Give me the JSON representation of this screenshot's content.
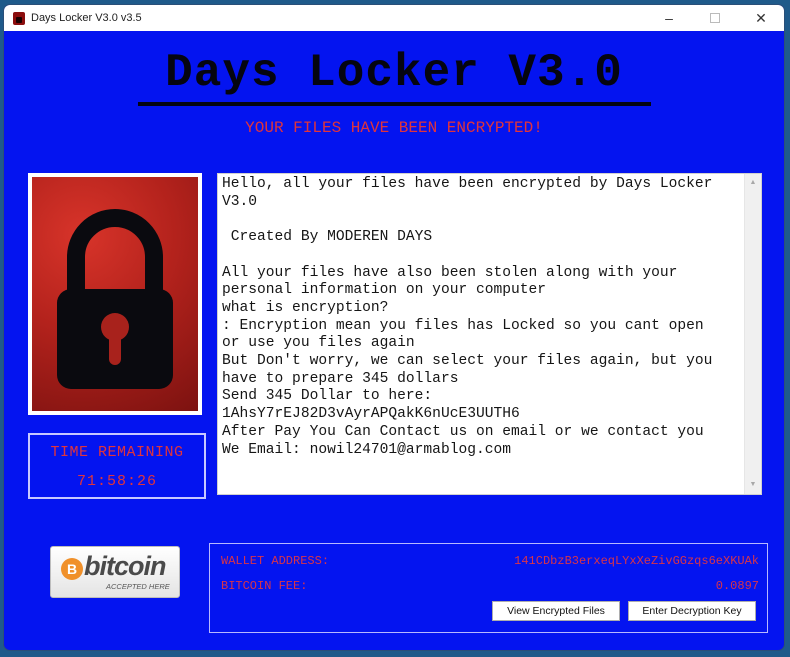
{
  "window": {
    "title": "Days Locker V3.0 v3.5",
    "controls": {
      "minimize": "–",
      "close": "✕"
    }
  },
  "header": {
    "title": "Days Locker V3.0",
    "subtitle": "YOUR FILES HAVE BEEN ENCRYPTED!"
  },
  "lock_image": {
    "icon": "padlock-icon"
  },
  "timer": {
    "label": "TIME REMAINING",
    "value": "71:58:26"
  },
  "ransom_note": {
    "text": "Hello, all your files have been encrypted by Days Locker\nV3.0\n\n Created By MODEREN DAYS\n\nAll your files have also been stolen along with your\npersonal information on your computer\nwhat is encryption?\n: Encryption mean you files has Locked so you cant open\nor use you files again\nBut Don't worry, we can select your files again, but you\nhave to prepare 345 dollars\nSend 345 Dollar to here:\n1AhsY7rEJ82D3vAyrAPQakK6nUcE3UUTH6\nAfter Pay You Can Contact us on email or we contact you\nWe Email: nowil24701@armablog.com",
    "scroll_up": "▲",
    "scroll_down": "▼"
  },
  "bitcoin_badge": {
    "symbol": "B",
    "word": "bitcoin",
    "tagline": "ACCEPTED HERE"
  },
  "payment": {
    "wallet_label": "WALLET ADDRESS:",
    "wallet_value": "141CDbzB3erxeqLYxXeZivGGzqs6eXKUAk",
    "fee_label": "BITCOIN FEE:",
    "fee_value": "0.0897",
    "view_button": "View Encrypted Files",
    "key_button": "Enter Decryption Key"
  }
}
